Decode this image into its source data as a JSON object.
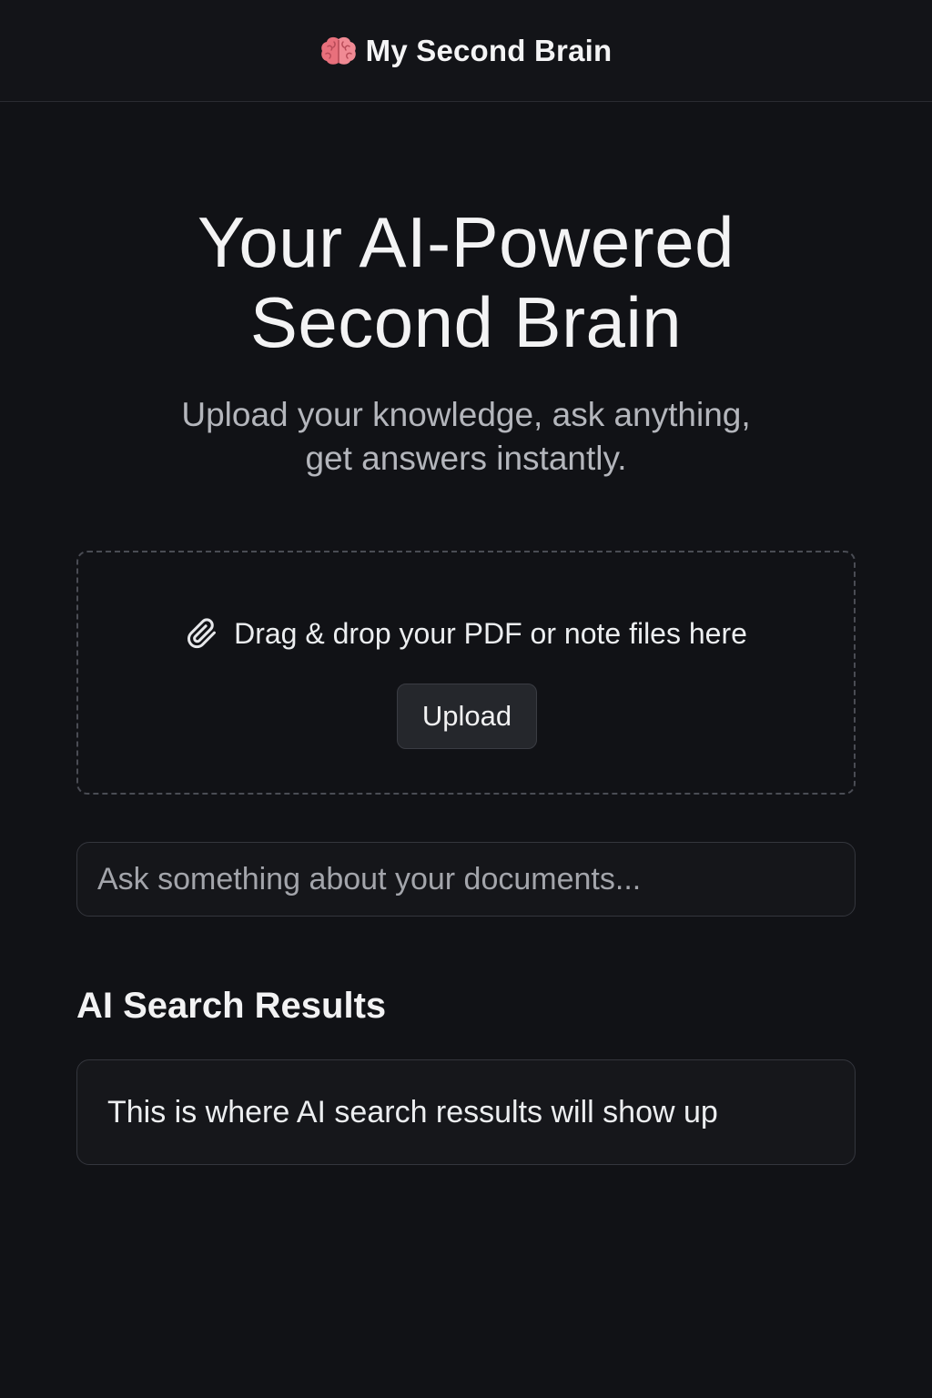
{
  "header": {
    "icon": "brain-icon",
    "title": "My Second Brain"
  },
  "hero": {
    "title_line1": "Your AI-Powered",
    "title_line2": "Second Brain",
    "subtitle_line1": "Upload your knowledge, ask anything,",
    "subtitle_line2": "get answers instantly."
  },
  "upload": {
    "icon": "paperclip-icon",
    "prompt": "Drag & drop your PDF or note files here",
    "button_label": "Upload"
  },
  "search": {
    "placeholder": "Ask something about your documents...",
    "value": ""
  },
  "results": {
    "heading": "AI Search Results",
    "text": "This is where AI search ressults will show up"
  },
  "colors": {
    "background": "#111216",
    "header_bg": "#131418",
    "text_primary": "#f2f2f3",
    "text_muted": "#b4b6bc",
    "border": "#34363d",
    "button_bg": "#25272c",
    "brain_pink": "#e8707c"
  }
}
